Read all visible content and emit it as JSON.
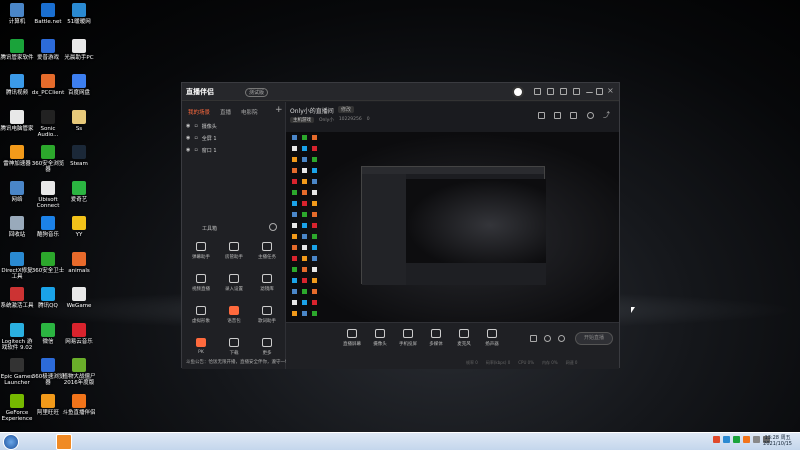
{
  "desktop": {
    "icons": [
      {
        "label": "计算机",
        "color": "#4a86c8"
      },
      {
        "label": "Battle.net",
        "color": "#1a6fd1"
      },
      {
        "label": "51暖暖网",
        "color": "#2a8ad2"
      },
      {
        "label": "腾讯管家软件",
        "color": "#1aa33a"
      },
      {
        "label": "爱普游戏",
        "color": "#2c6bd9"
      },
      {
        "label": "光晨助手PC",
        "color": "#e8e8e8"
      },
      {
        "label": "腾讯视频",
        "color": "#3b9ae8"
      },
      {
        "label": "dx_PCClient",
        "color": "#e56b2b"
      },
      {
        "label": "百度网盘",
        "color": "#3d7ff0"
      },
      {
        "label": "腾讯电脑管家",
        "color": "#e8e8e8"
      },
      {
        "label": "Sonic Audio...",
        "color": "#222"
      },
      {
        "label": "Ss",
        "color": "#e7c97a"
      },
      {
        "label": "雷神加速器",
        "color": "#f29a1a"
      },
      {
        "label": "360安全浏览器",
        "color": "#2ca82c"
      },
      {
        "label": "Steam",
        "color": "#1b2838"
      },
      {
        "label": "网络",
        "color": "#4a86c8"
      },
      {
        "label": "Ubisoft Connect",
        "color": "#e8e8e8"
      },
      {
        "label": "爱奇艺",
        "color": "#2bb541"
      },
      {
        "label": "回收站",
        "color": "#9ab"
      },
      {
        "label": "酷狗音乐",
        "color": "#1c82e8"
      },
      {
        "label": "YY",
        "color": "#f2c21a"
      },
      {
        "label": "DirectX修复工具",
        "color": "#2a8ad2"
      },
      {
        "label": "360安全卫士",
        "color": "#2ca82c"
      },
      {
        "label": "animals",
        "color": "#e86a2b"
      },
      {
        "label": "系统激活工具",
        "color": "#c33"
      },
      {
        "label": "腾讯QQ",
        "color": "#1aa3e8"
      },
      {
        "label": "WeGame",
        "color": "#e8e8e8"
      },
      {
        "label": "Logitech 游戏软件 9.02",
        "color": "#2ab0e0"
      },
      {
        "label": "微信",
        "color": "#2bb541"
      },
      {
        "label": "网易云音乐",
        "color": "#d9232d"
      },
      {
        "label": "Epic Games Launcher",
        "color": "#333"
      },
      {
        "label": "360极速浏览器",
        "color": "#2c6bd9"
      },
      {
        "label": "植物大战僵尸2016年度版",
        "color": "#6aae2a"
      },
      {
        "label": "GeForce Experience",
        "color": "#76b900"
      },
      {
        "label": "阿里旺旺",
        "color": "#f29a1a"
      },
      {
        "label": "斗鱼直播伴侣",
        "color": "#f2741a"
      }
    ]
  },
  "taskbar": {
    "time": "13:28 周五",
    "date": "2021/10/15"
  },
  "app": {
    "title": "直播伴侣",
    "beta": "测试版",
    "tabs": [
      "我的场景",
      "直播",
      "电影院"
    ],
    "sources": [
      {
        "name": "摄像头"
      },
      {
        "name": "全屏 1"
      },
      {
        "name": "窗口 1"
      }
    ],
    "tools_title": "工具箱",
    "tools": [
      {
        "label": "弹幕助手"
      },
      {
        "label": "房管助手"
      },
      {
        "label": "主播任务"
      },
      {
        "label": "视频直播"
      },
      {
        "label": "录入设置"
      },
      {
        "label": "滤镜库"
      },
      {
        "label": "虚拟形象"
      },
      {
        "label": "语音包"
      },
      {
        "label": "歌词助手"
      },
      {
        "label": "PK"
      },
      {
        "label": "下载"
      },
      {
        "label": "更多"
      }
    ],
    "notice": "斗鱼公告：恰饭无限开播，直播安全伴你，遵守一切规则",
    "room_name": "Only小的直播间",
    "room_edit": "修改",
    "room_category": "主机游戏",
    "room_owner": "Only小",
    "room_id": "10229256",
    "room_fans": "0",
    "bottom_buttons": [
      {
        "label": "直播屏幕"
      },
      {
        "label": "摄像头"
      },
      {
        "label": "手机投屏"
      },
      {
        "label": "多媒体"
      },
      {
        "label": "麦克风"
      },
      {
        "label": "扬声器"
      }
    ],
    "go_live": "开始直播",
    "stats": [
      "帧率 0",
      "码率(kbps) 0",
      "CPU 0%",
      "内存 0%",
      "网速 0"
    ]
  }
}
